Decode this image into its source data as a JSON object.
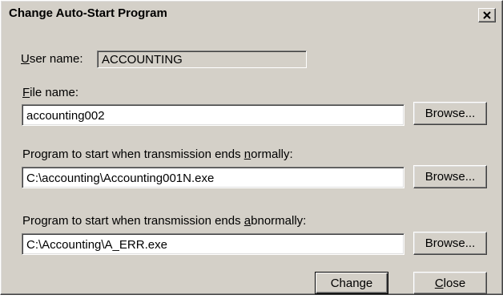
{
  "window": {
    "title": "Change Auto-Start Program",
    "close_glyph": "✕"
  },
  "user_name": {
    "label_u": "U",
    "label_rest": "ser name:",
    "value": "ACCOUNTING"
  },
  "file_name": {
    "label_u": "F",
    "label_rest": "ile name:",
    "value": "accounting002",
    "browse_label": "Browse..."
  },
  "normal_program": {
    "label_pre": "Program to start when transmission ends ",
    "label_u": "n",
    "label_rest": "ormally:",
    "value": "C:\\accounting\\Accounting001N.exe",
    "browse_label": "Browse..."
  },
  "abnormal_program": {
    "label_pre": "Program to start when transmission ends ",
    "label_u": "a",
    "label_rest": "bnormally:",
    "value": "C:\\Accounting\\A_ERR.exe",
    "browse_label": "Browse..."
  },
  "actions": {
    "change_label": "Change",
    "close_u": "C",
    "close_rest": "lose"
  }
}
